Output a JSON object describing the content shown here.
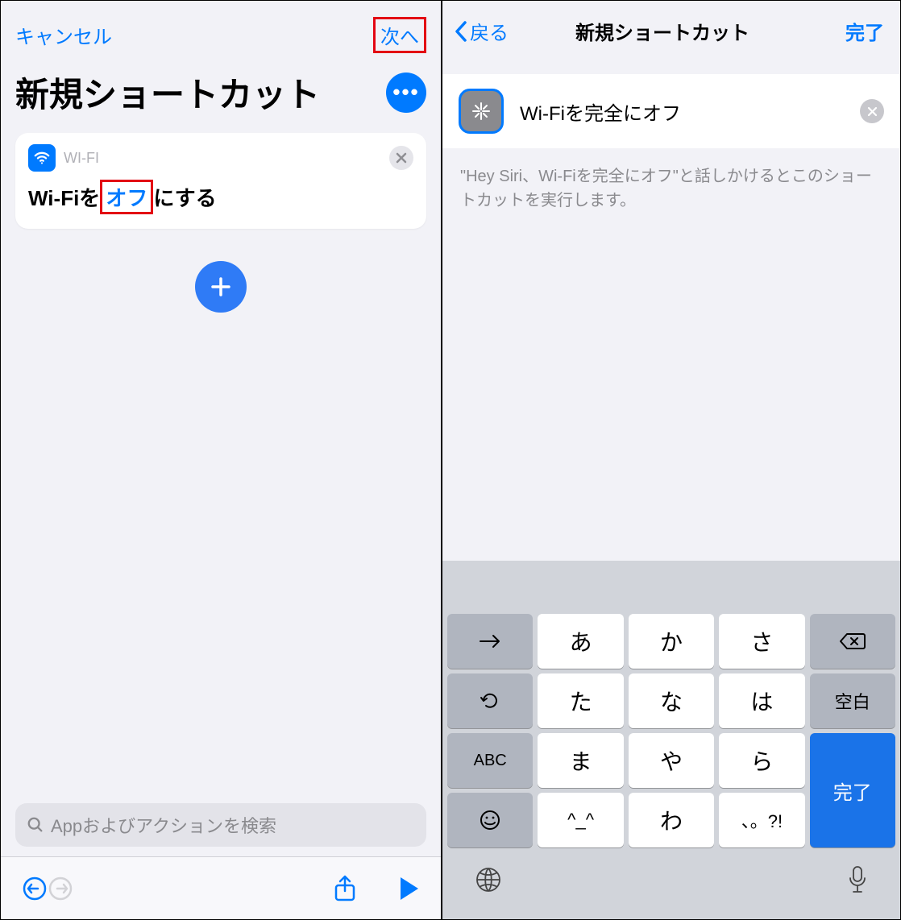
{
  "left": {
    "cancel": "キャンセル",
    "next": "次へ",
    "title": "新規ショートカット",
    "card": {
      "app": "WI-FI",
      "pre": "Wi-Fiを",
      "toggle": "オフ",
      "post": "にする"
    },
    "search_placeholder": "Appおよびアクションを検索"
  },
  "right": {
    "back": "戻る",
    "title": "新規ショートカット",
    "done": "完了",
    "name_value": "Wi-Fiを完全にオフ",
    "siri_hint": "\"Hey Siri、Wi-Fiを完全にオフ\"と話しかけるとこのショートカットを実行します。"
  },
  "keyboard": {
    "rows": [
      [
        "→",
        "あ",
        "か",
        "さ",
        "⌫"
      ],
      [
        "↺",
        "た",
        "な",
        "は",
        "空白"
      ],
      [
        "ABC",
        "ま",
        "や",
        "ら",
        "完了"
      ],
      [
        "☻",
        "^_^",
        "わ",
        "、。?!",
        ""
      ]
    ]
  }
}
